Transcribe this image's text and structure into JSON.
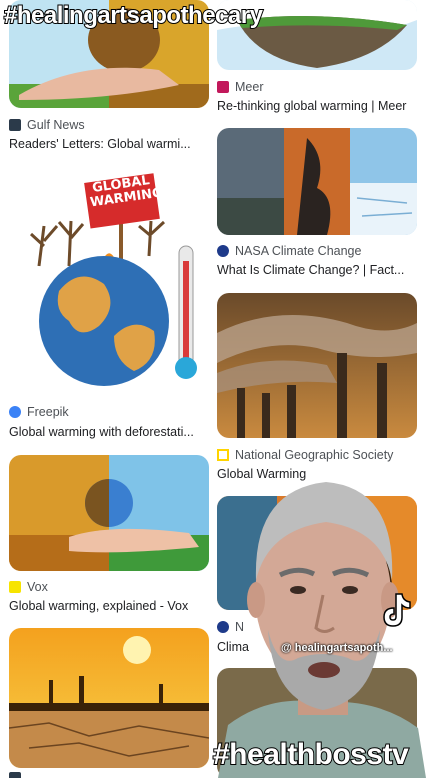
{
  "overlays": {
    "top_hashtag": "#healingartsapothecary",
    "bottom_hashtag": "#healthbosstv",
    "tiktok_username": "@ healingartsapoth..."
  },
  "left_column": [
    {
      "source": "Gulf News",
      "title": "Readers' Letters: Global warmi...",
      "favicon_color": "#2b3a4a",
      "icon": "gulf-news-favicon"
    },
    {
      "source": "Freepik",
      "title": "Global warming with deforestati...",
      "favicon_color": "#3b82f6",
      "icon": "freepik-favicon",
      "badge_text": "GLOBAL WARMING"
    },
    {
      "source": "Vox",
      "title": "Global warming, explained - Vox",
      "favicon_color": "#f7e400",
      "icon": "vox-favicon"
    }
  ],
  "right_column": [
    {
      "source": "Meer",
      "title": "Re-thinking global warming | Meer",
      "favicon_color": "#c2185b",
      "icon": "meer-favicon"
    },
    {
      "source": "NASA Climate Change",
      "title": "What Is Climate Change? | Fact...",
      "favicon_color": "#1e3a8a",
      "icon": "nasa-favicon"
    },
    {
      "source": "National Geographic Society",
      "title": "Global Warming",
      "favicon_color": "#ffd400",
      "icon": "natgeo-favicon"
    },
    {
      "source": "N",
      "title": "Clima",
      "favicon_color": "#1e3a8a",
      "icon": "nasa-favicon"
    }
  ]
}
